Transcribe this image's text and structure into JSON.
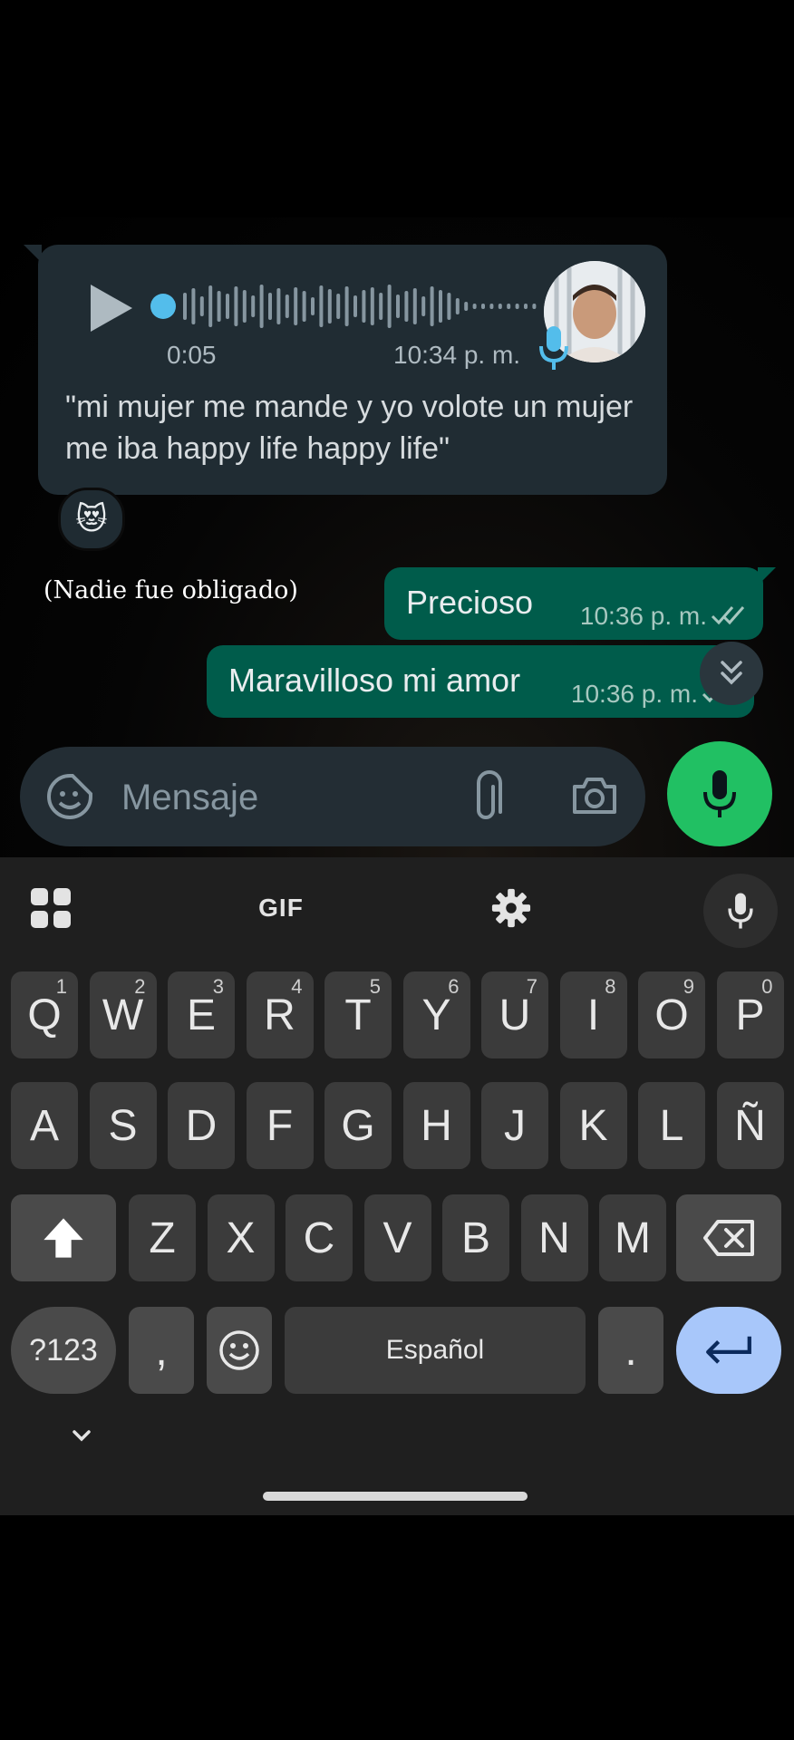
{
  "voice_message": {
    "duration": "0:05",
    "time": "10:34 p. m.",
    "progress": 0.0,
    "transcript": "\"mi mujer me mande y yo volote un mujer me iba happy life happy life\"",
    "reaction": "😻"
  },
  "caption": "(Nadie fue obligado)",
  "outgoing": [
    {
      "text": "Precioso",
      "time": "10:36 p. m.",
      "status": "read"
    },
    {
      "text": "Maravilloso mi amor",
      "time": "10:36 p. m.",
      "status": "read"
    }
  ],
  "input_bar": {
    "placeholder": "Mensaje"
  },
  "keyboard": {
    "toolbar": {
      "gif_label": "GIF"
    },
    "row1": [
      {
        "key": "Q",
        "hint": "1"
      },
      {
        "key": "W",
        "hint": "2"
      },
      {
        "key": "E",
        "hint": "3"
      },
      {
        "key": "R",
        "hint": "4"
      },
      {
        "key": "T",
        "hint": "5"
      },
      {
        "key": "Y",
        "hint": "6"
      },
      {
        "key": "U",
        "hint": "7"
      },
      {
        "key": "I",
        "hint": "8"
      },
      {
        "key": "O",
        "hint": "9"
      },
      {
        "key": "P",
        "hint": "0"
      }
    ],
    "row2": [
      "A",
      "S",
      "D",
      "F",
      "G",
      "H",
      "J",
      "K",
      "L",
      "Ñ"
    ],
    "row3": [
      "Z",
      "X",
      "C",
      "V",
      "B",
      "N",
      "M"
    ],
    "bottom_row": {
      "symbols_label": "?123",
      "comma_label": ",",
      "space_label": "Español",
      "period_label": "."
    }
  },
  "colors": {
    "incoming_bubble": "#202c33",
    "outgoing_bubble": "#005c4b",
    "accent_green": "#21c063",
    "enter_key": "#a8c7fa",
    "waveform_played": "#53bdeb"
  }
}
